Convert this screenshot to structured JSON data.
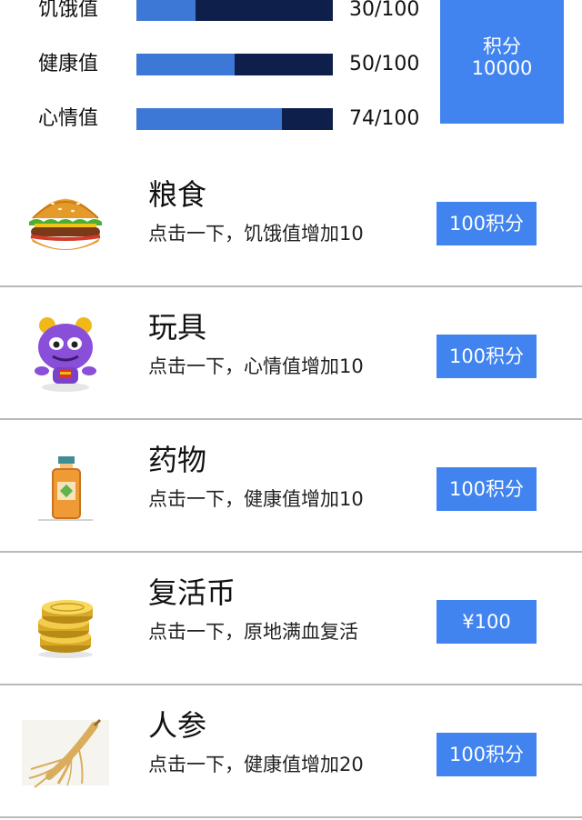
{
  "stats": [
    {
      "label": "饥饿值",
      "value": "30/100",
      "fraction": 0.3
    },
    {
      "label": "健康值",
      "value": "50/100",
      "fraction": 0.5
    },
    {
      "label": "心情值",
      "value": "74/100",
      "fraction": 0.74
    }
  ],
  "points": {
    "label": "积分",
    "value": "10000"
  },
  "items": [
    {
      "title": "粮食",
      "desc": "点击一下，饥饿值增加10",
      "button": "100积分",
      "icon": "hamburger-icon"
    },
    {
      "title": "玩具",
      "desc": "点击一下，心情值增加10",
      "button": "100积分",
      "icon": "purple-monster-toy-icon"
    },
    {
      "title": "药物",
      "desc": "点击一下，健康值增加10",
      "button": "100积分",
      "icon": "medicine-bottle-icon"
    },
    {
      "title": "复活币",
      "desc": "点击一下，原地满血复活",
      "button": "¥100",
      "icon": "gold-coins-icon"
    },
    {
      "title": "人参",
      "desc": "点击一下，健康值增加20",
      "button": "100积分",
      "icon": "ginseng-root-icon"
    }
  ],
  "colors": {
    "accent": "#4184f0",
    "bar_fill": "#3d78d6",
    "bar_track": "#0d1f4a",
    "divider": "#b9b9b9"
  }
}
